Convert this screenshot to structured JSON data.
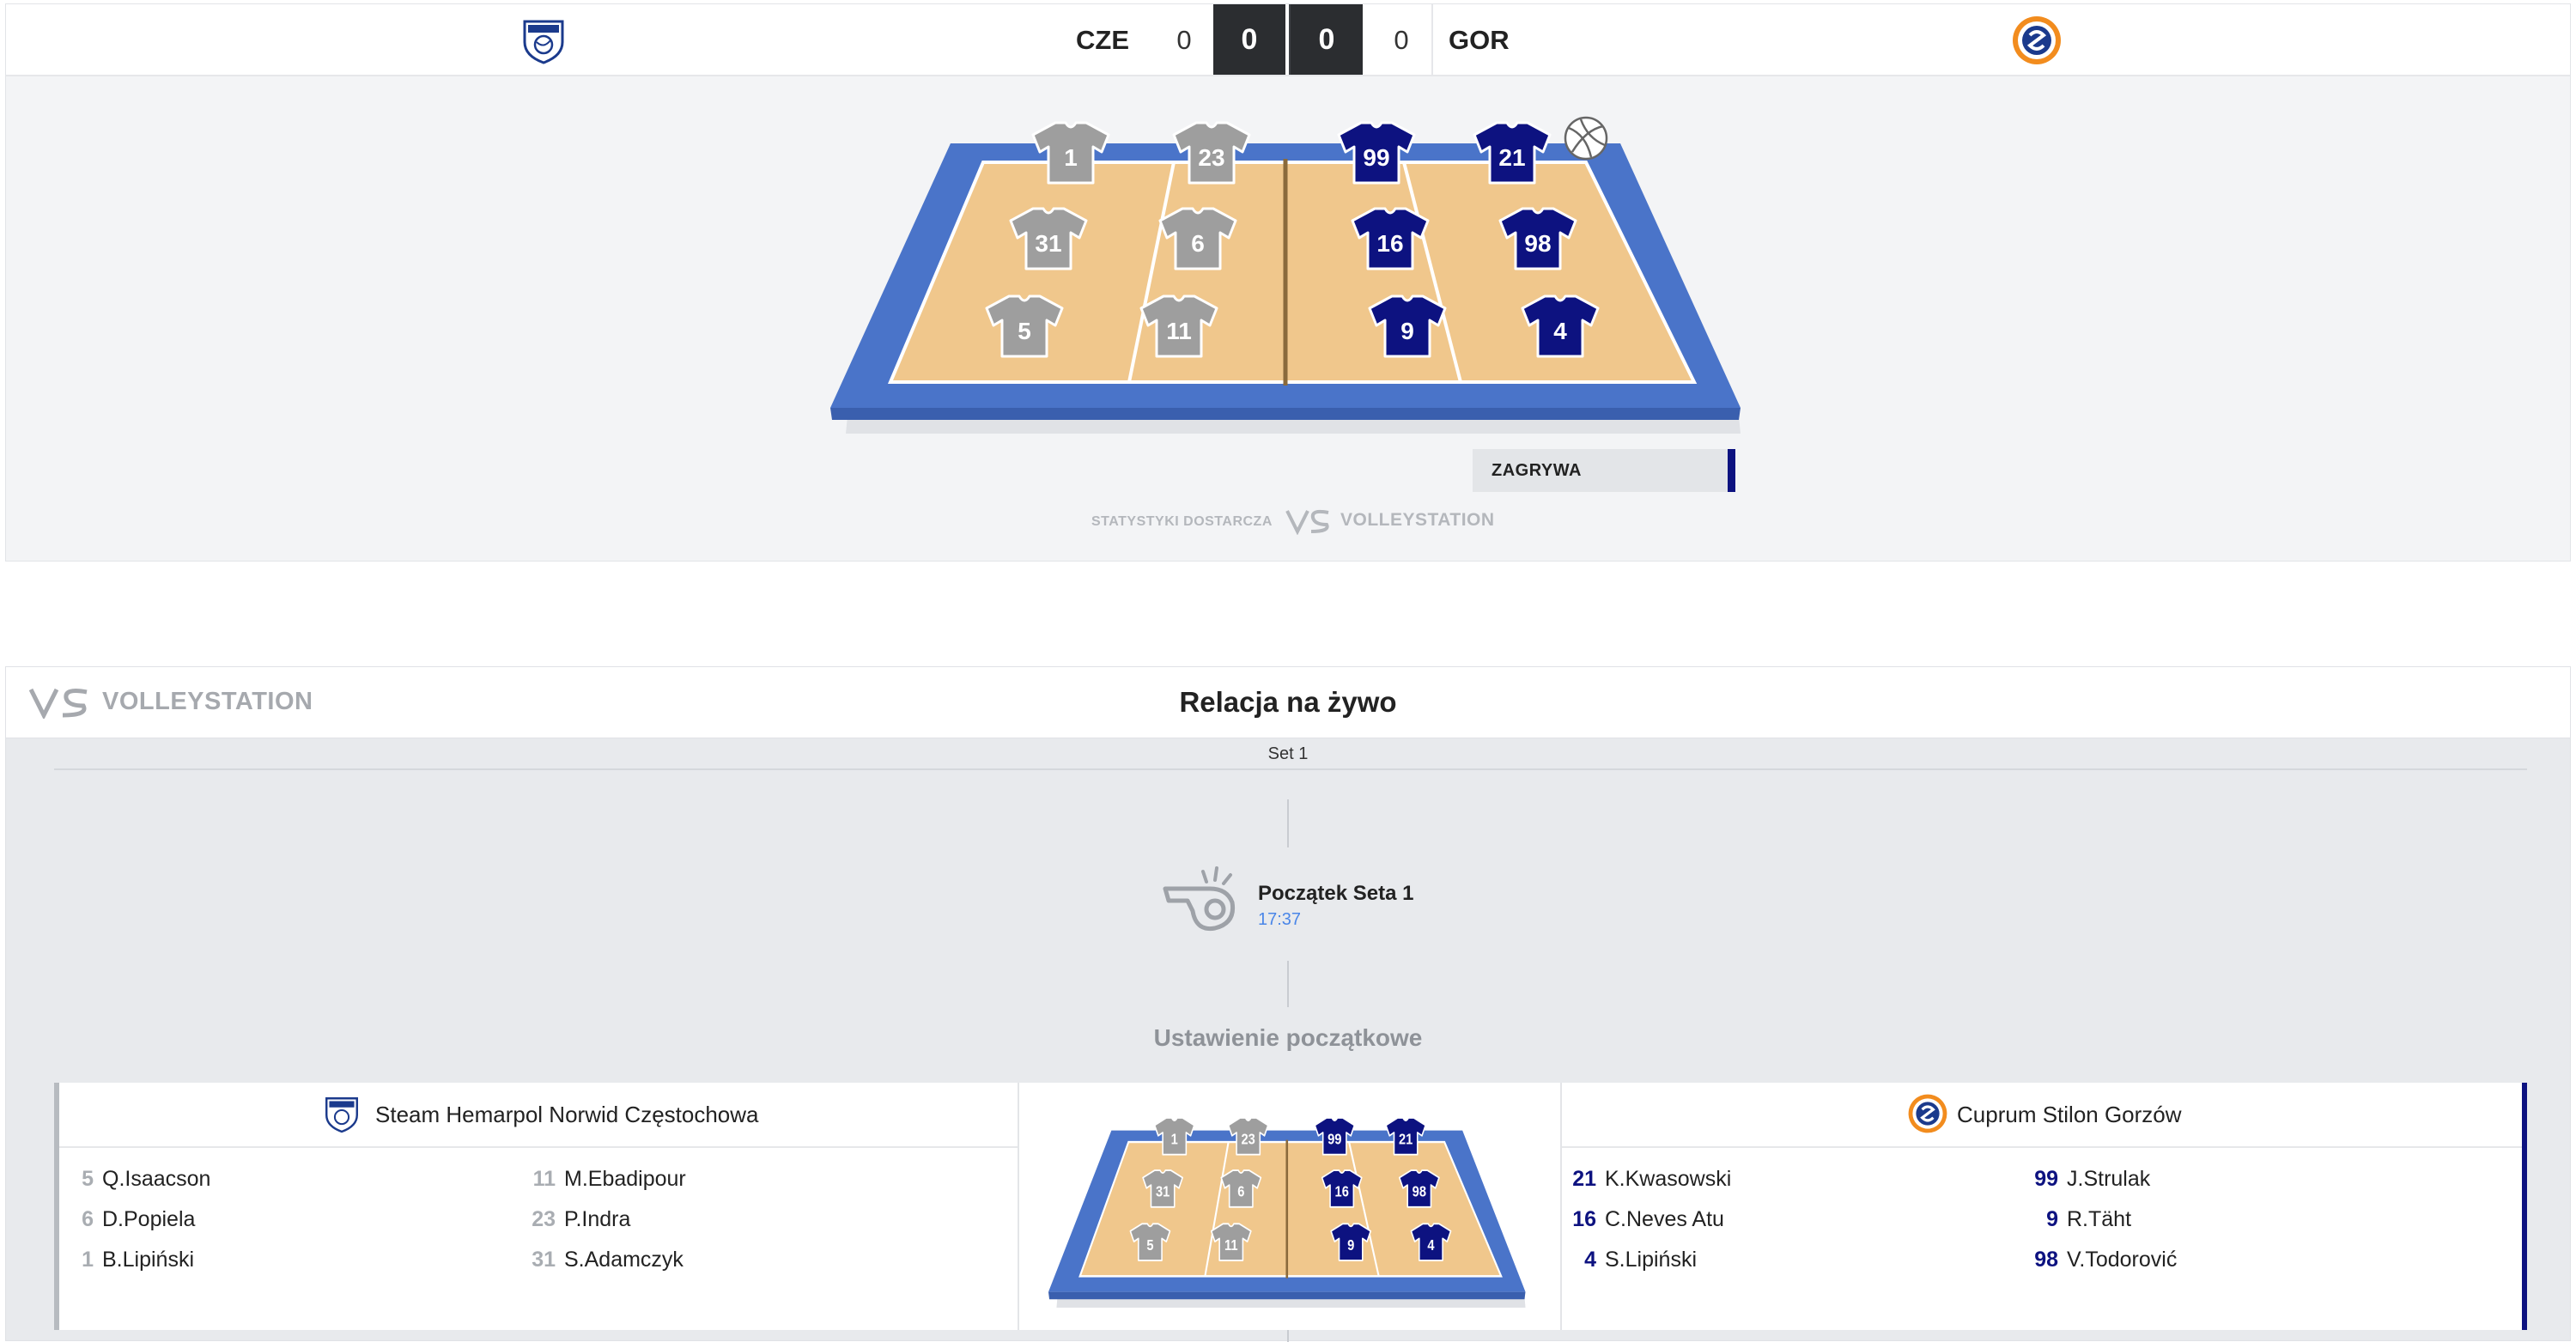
{
  "colors": {
    "home_jersey": "#9e9e9e",
    "away_jersey": "#0d1280",
    "court_floor": "#f0c78c",
    "court_outer": "#4a74c9",
    "accent_away": "#0d1280",
    "time_blue": "#4a86e8"
  },
  "scoreboard": {
    "home_code": "CZE",
    "away_code": "GOR",
    "home_sets": "0",
    "away_sets": "0",
    "home_points": "0",
    "away_points": "0",
    "home_logo": "norwid-shield-logo",
    "away_logo": "cuprum-round-logo"
  },
  "court": {
    "home_players": [
      "1",
      "23",
      "31",
      "6",
      "5",
      "11"
    ],
    "away_players": [
      "99",
      "21",
      "16",
      "98",
      "9",
      "4"
    ],
    "serving_team": "away",
    "ball_icon": "volleyball-icon"
  },
  "serve": {
    "label": "ZAGRYWA"
  },
  "credit": {
    "label": "STATYSTYKI DOSTARCZA",
    "brand": "VOLLEYSTATION"
  },
  "live": {
    "brand": "VOLLEYSTATION",
    "title": "Relacja na żywo",
    "set_label": "Set 1",
    "event": {
      "icon": "whistle-icon",
      "title": "Początek Seta 1",
      "time": "17:37"
    },
    "lineup_title": "Ustawienie początkowe"
  },
  "lineup": {
    "home": {
      "name": "Steam Hemarpol Norwid Częstochowa",
      "players": [
        {
          "num": "5",
          "name": "Q.Isaacson"
        },
        {
          "num": "11",
          "name": "M.Ebadipour"
        },
        {
          "num": "6",
          "name": "D.Popiela"
        },
        {
          "num": "23",
          "name": "P.Indra"
        },
        {
          "num": "1",
          "name": "B.Lipiński"
        },
        {
          "num": "31",
          "name": "S.Adamczyk"
        }
      ]
    },
    "away": {
      "name": "Cuprum Stilon Gorzów",
      "players": [
        {
          "num": "21",
          "name": "K.Kwasowski"
        },
        {
          "num": "99",
          "name": "J.Strulak"
        },
        {
          "num": "16",
          "name": "C.Neves Atu"
        },
        {
          "num": "9",
          "name": "R.Täht"
        },
        {
          "num": "4",
          "name": "S.Lipiński"
        },
        {
          "num": "98",
          "name": "V.Todorović"
        }
      ]
    }
  }
}
